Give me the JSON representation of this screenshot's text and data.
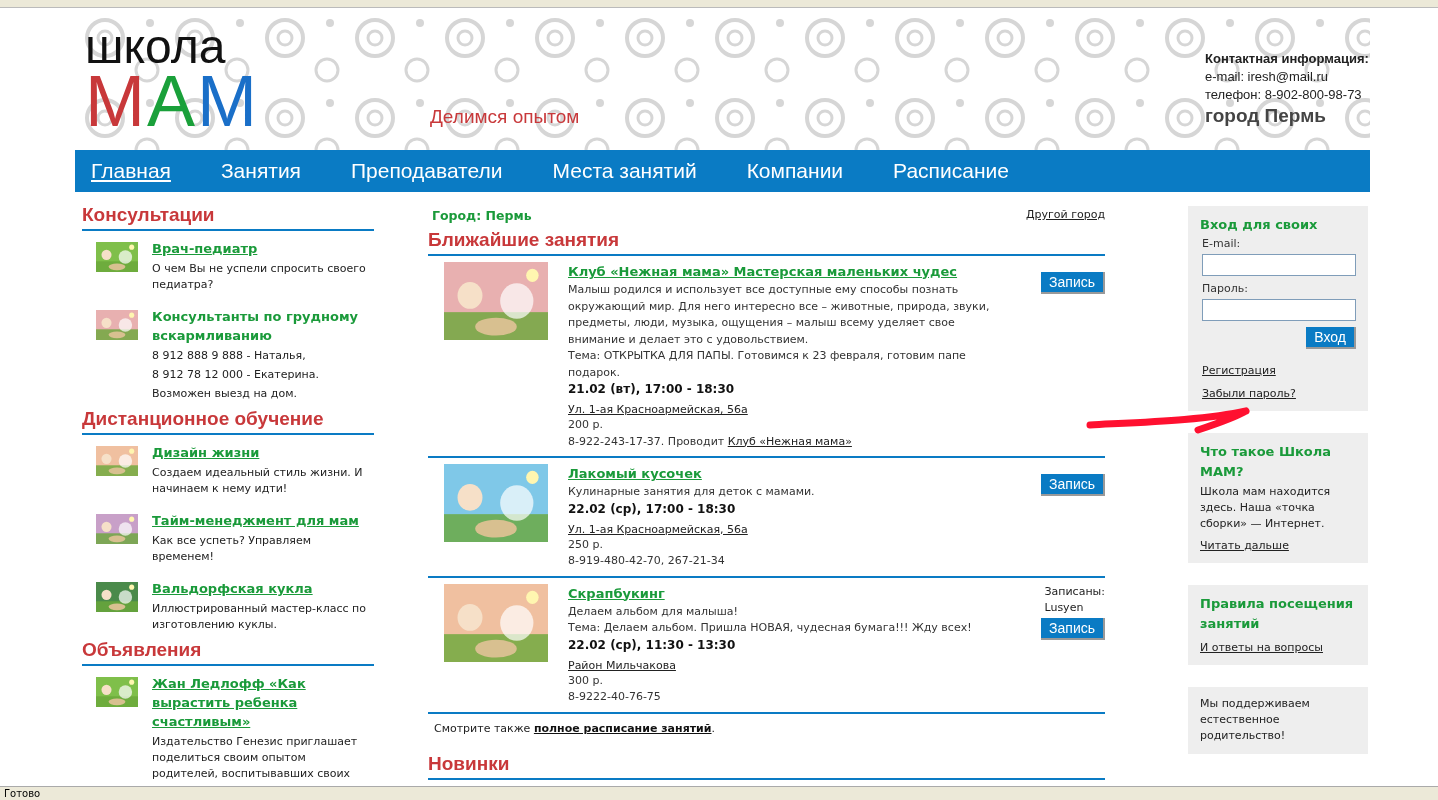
{
  "logo": {
    "top": "школа",
    "letters": [
      {
        "text": "М",
        "color": "#c8383a"
      },
      {
        "text": "А",
        "color": "#1aa03a"
      },
      {
        "text": "М",
        "color": "#1a6fc8"
      }
    ]
  },
  "slogan": "Делимся опытом",
  "contact": {
    "title": "Контактная информация:",
    "lines": [
      "e-mail: iresh@mail.ru",
      "телефон: 8-902-800-98-73"
    ],
    "city": "город Пермь"
  },
  "nav": [
    {
      "label": "Главная",
      "selected": true
    },
    {
      "label": "Занятия",
      "selected": false
    },
    {
      "label": "Преподаватели",
      "selected": false
    },
    {
      "label": "Места занятий",
      "selected": false
    },
    {
      "label": "Компании",
      "selected": false
    },
    {
      "label": "Расписание",
      "selected": false
    }
  ],
  "left_sections": [
    {
      "title": "Консультации",
      "items": [
        {
          "title": "Врач-педиатр",
          "linked": true,
          "lines": [
            "О чем Вы не успели спросить своего педиатра?"
          ]
        },
        {
          "title": "Консультанты по грудному вскармливанию",
          "linked": false,
          "lines": [
            "8 912 888 9 888 - Наталья,",
            "8 912 78 12 000 - Екатерина.",
            "Возможен выезд на дом."
          ]
        }
      ]
    },
    {
      "title": "Дистанционное обучение",
      "items": [
        {
          "title": "Дизайн жизни",
          "linked": true,
          "lines": [
            "Создаем идеальный стиль жизни. И начинаем к нему идти!"
          ]
        },
        {
          "title": "Тайм-менеджмент для мам",
          "linked": true,
          "lines": [
            "Как все успеть? Управляем временем!"
          ]
        },
        {
          "title": "Вальдорфская кукла",
          "linked": true,
          "lines": [
            "Иллюстрированный мастер-класс по изготовлению куклы."
          ]
        }
      ]
    },
    {
      "title": "Объявления",
      "items": [
        {
          "title": "Жан Ледлофф «Как вырастить ребенка счастливым»",
          "linked": true,
          "lines": [
            "Издательство Генезис приглашает поделиться своим опытом родителей, воспитывавших своих"
          ]
        }
      ]
    }
  ],
  "city": {
    "label": "Город: Пермь",
    "change_link": "Другой город"
  },
  "upcoming": {
    "title": "Ближайшие занятия",
    "events": [
      {
        "title": "Клуб «Нежная мама» Мастерская маленьких чудес",
        "lines": [
          "Малыш родился и использует все доступные ему способы познать окружающий мир. Для него интересно все – животные, природа, звуки, предметы, люди, музыка, ощущения – малыш всему уделяет свое внимание и делает это с удовольствием.",
          "Тема: ОТКРЫТКА ДЛЯ ПАПЫ. Готовимся к 23 февраля, готовим папе подарок."
        ],
        "when": "21.02 (вт), 17:00 - 18:30",
        "address": "Ул. 1-ая Красноармейская, 56а",
        "price": "200 р.",
        "contact": "8-922-243-17-37. Проводит",
        "host_link": "Клуб «Нежная мама»",
        "button": "Запись"
      },
      {
        "title": "Лакомый кусочек",
        "lines": [
          "Кулинарные занятия для деток с мамами."
        ],
        "when": "22.02 (ср), 17:00 - 18:30",
        "address": "Ул. 1-ая Красноармейская, 56а",
        "price": "250 р.",
        "contact": "8-919-480-42-70, 267-21-34",
        "button": "Запись"
      },
      {
        "title": "Скрапбукинг",
        "lines": [
          "Делаем альбом для малыша!",
          "Тема: Делаем альбом. Пришла НОВАЯ, чудесная бумага!!! Жду всех!"
        ],
        "when": "22.02 (ср), 11:30 - 13:30",
        "address": "Район Мильчакова",
        "price": "300 р.",
        "contact": "8-9222-40-76-75",
        "enrolled_label": "Записаны:",
        "enrolled": "Lusyen",
        "button": "Запись"
      }
    ],
    "see_also": "Смотрите также",
    "see_also_link": "полное расписание занятий",
    "see_also_end": "."
  },
  "news": {
    "title": "Новинки"
  },
  "login": {
    "title": "Вход для своих",
    "email_label": "E-mail:",
    "password_label": "Пароль:",
    "button": "Вход",
    "links": [
      "Регистрация",
      "Забыли пароль?"
    ]
  },
  "boxes": [
    {
      "title": "Что такое Школа МАМ?",
      "text": "Школа мам находится здесь. Наша «точка сборки» — Интернет.",
      "link": "Читать дальше"
    },
    {
      "title": "Правила посещения занятий",
      "link": "И ответы на вопросы"
    },
    {
      "text": "Мы поддерживаем естественное родительство!"
    }
  ],
  "status_bar": "Готово"
}
